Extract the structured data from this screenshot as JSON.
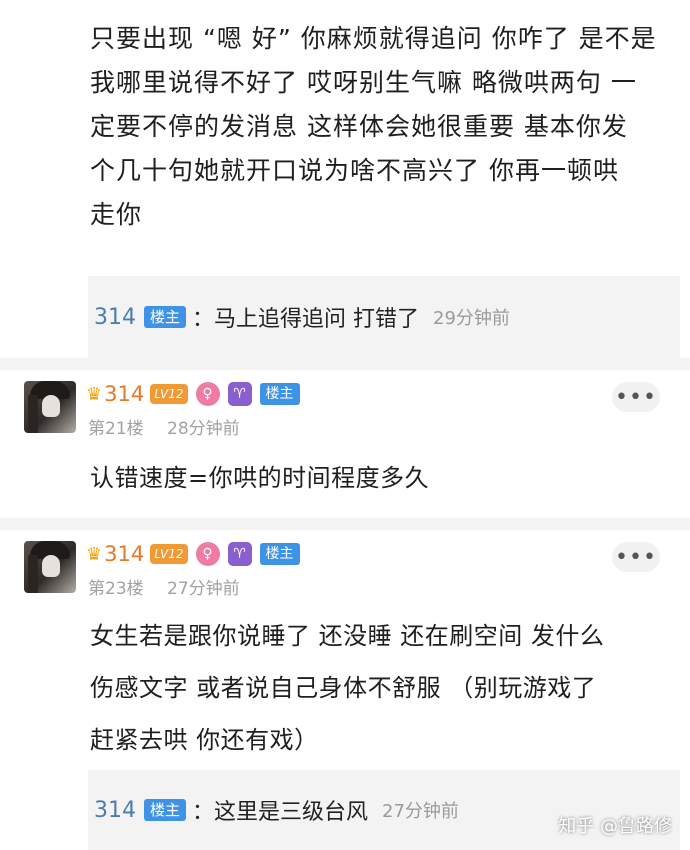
{
  "post1": {
    "lines": [
      "只要出现 “嗯 好” 你麻烦就得追问 你咋了 是不是",
      "我哪里说得不好了 哎呀别生气嘛 略微哄两句 一",
      "定要不停的发消息 这样体会她很重要 基本你发",
      "个几十句她就开口说为啥不高兴了 你再一顿哄",
      "走你"
    ]
  },
  "reply1": {
    "user": "314",
    "badge": "楼主",
    "text": "：马上追得追问 打错了",
    "time": "29分钟前"
  },
  "floor21": {
    "username": "314",
    "level": "LV12",
    "gender_icon": "♀",
    "zodiac_icon": "♈",
    "badge": "楼主",
    "floor": "第21楼",
    "time": "28分钟前",
    "more": "•••",
    "text": "认错速度=你哄的时间程度多久"
  },
  "floor23": {
    "username": "314",
    "level": "LV12",
    "gender_icon": "♀",
    "zodiac_icon": "♈",
    "badge": "楼主",
    "floor": "第23楼",
    "time": "27分钟前",
    "more": "•••",
    "lines": [
      "女生若是跟你说睡了 还没睡 还在刷空间 发什么",
      "伤感文字 或者说自己身体不舒服 （别玩游戏了",
      "赶紧去哄 你还有戏）"
    ]
  },
  "reply2": {
    "user": "314",
    "badge": "楼主",
    "text": "：这里是三级台风",
    "time": "27分钟前"
  },
  "watermark": "知乎 @鲁路修",
  "icons": {
    "crown": "crown-icon",
    "more": "more-dots-icon"
  },
  "colors": {
    "username": "#e07a2c",
    "reply_user": "#4d7cb2",
    "badge_blue": "#3f93e6",
    "female": "#ef7ba3",
    "aries": "#8a5fcf",
    "level": "#f19a34"
  }
}
